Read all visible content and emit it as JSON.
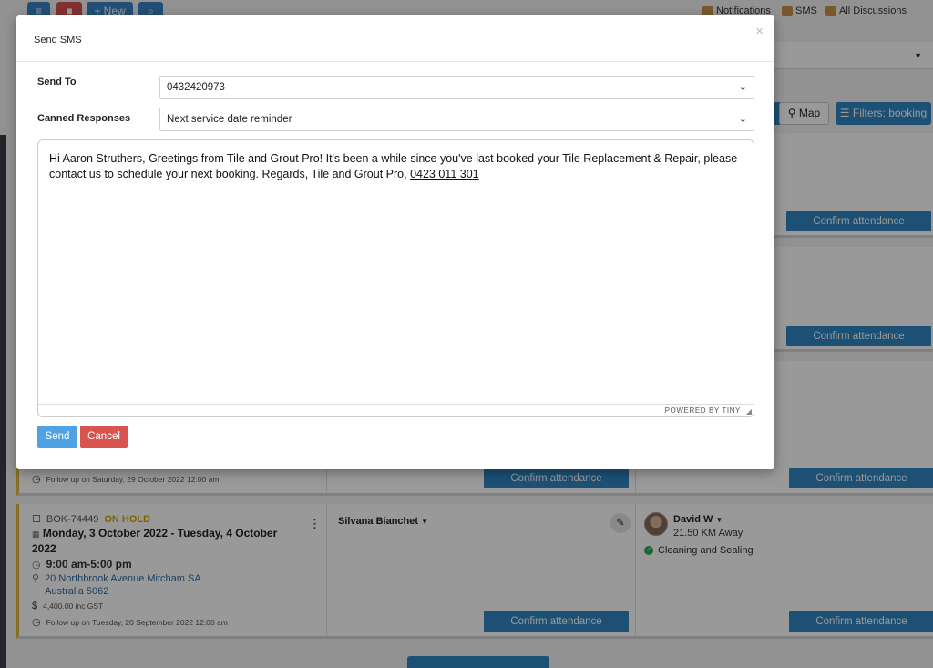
{
  "topbar": {
    "new_label": "+ New",
    "links": [
      {
        "label": "Notifications",
        "icon": "notification-icon"
      },
      {
        "label": "SMS",
        "icon": "sms-icon"
      },
      {
        "label": "All Discussions",
        "icon": "discussion-icon"
      }
    ]
  },
  "toolbar": {
    "map_label": "Map",
    "filters_label": "Filters: booking"
  },
  "cards": [
    {
      "confirm_right": "Confirm attendance"
    },
    {
      "confirm_right": "Confirm attendance"
    },
    {
      "follow_up": "Follow up on  Saturday, 29 October 2022 12:00 am",
      "confirm_mid": "Confirm attendance",
      "confirm_right": "Confirm attendance"
    },
    {
      "booking_id": "BOK-74449",
      "status": "ON HOLD",
      "dates": "Monday, 3 October 2022 - Tuesday, 4 October 2022",
      "time": "9:00 am-5:00 pm",
      "address_line1": "20 Northbrook Avenue Mitcham SA",
      "address_line2": "Australia 5062",
      "price": "4,400.00 inc GST",
      "follow_up": "Follow up on  Tuesday, 20 September 2022 12:00 am",
      "customer": "Silvana Bianchet",
      "technician": "David W",
      "distance": "21.50 KM Away",
      "service": "Cleaning and Sealing",
      "confirm_mid": "Confirm attendance",
      "confirm_right": "Confirm attendance"
    }
  ],
  "modal": {
    "title": "Send SMS",
    "close": "×",
    "send_to_label": "Send To",
    "send_to_value": "0432420973",
    "canned_label": "Canned Responses",
    "canned_value": "Next service date reminder",
    "message_text": "Hi Aaron Struthers, Greetings from Tile and Grout Pro! It's been a while since you've last booked your Tile Replacement & Repair, please contact us to schedule your next booking. Regards, Tile and Grout Pro,",
    "message_phone": "0423 011 301",
    "powered_by": "POWERED BY TINY",
    "send_label": "Send",
    "cancel_label": "Cancel"
  }
}
